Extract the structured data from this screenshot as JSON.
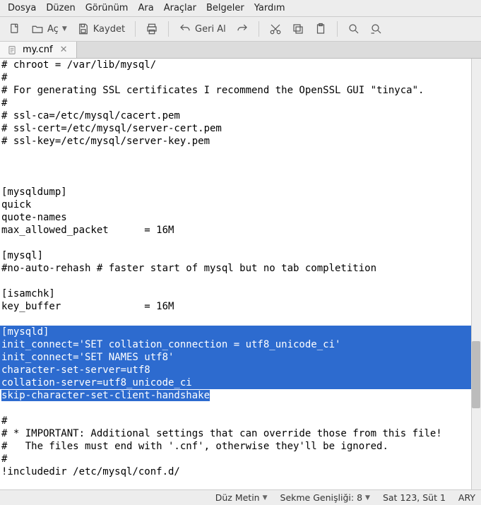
{
  "menubar": {
    "items": [
      "Dosya",
      "Düzen",
      "Görünüm",
      "Ara",
      "Araçlar",
      "Belgeler",
      "Yardım"
    ]
  },
  "toolbar": {
    "open_label": "Aç",
    "save_label": "Kaydet",
    "undo_label": "Geri Al"
  },
  "tab": {
    "filename": "my.cnf"
  },
  "editor": {
    "lines_before": [
      "# chroot = /var/lib/mysql/",
      "#",
      "# For generating SSL certificates I recommend the OpenSSL GUI \"tinyca\".",
      "#",
      "# ssl-ca=/etc/mysql/cacert.pem",
      "# ssl-cert=/etc/mysql/server-cert.pem",
      "# ssl-key=/etc/mysql/server-key.pem",
      "",
      "",
      "",
      "[mysqldump]",
      "quick",
      "quote-names",
      "max_allowed_packet      = 16M",
      "",
      "[mysql]",
      "#no-auto-rehash # faster start of mysql but no tab completition",
      "",
      "[isamchk]",
      "key_buffer              = 16M",
      ""
    ],
    "lines_selected": [
      "[mysqld]",
      "init_connect='SET collation_connection = utf8_unicode_ci'",
      "init_connect='SET NAMES utf8'",
      "character-set-server=utf8",
      "collation-server=utf8_unicode_ci",
      "skip-character-set-client-handshake"
    ],
    "lines_after": [
      "",
      "#",
      "# * IMPORTANT: Additional settings that can override those from this file!",
      "#   The files must end with '.cnf', otherwise they'll be ignored.",
      "#",
      "!includedir /etc/mysql/conf.d/"
    ]
  },
  "statusbar": {
    "filetype": "Düz Metin",
    "tabwidth_label": "Sekme Genişliği:",
    "tabwidth_value": "8",
    "position": "Sat 123, Süt 1",
    "mode": "ARY"
  }
}
